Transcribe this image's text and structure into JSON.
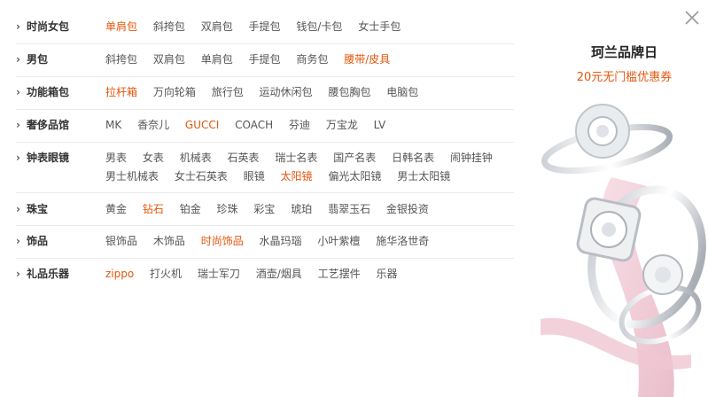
{
  "close_icon": "close-icon",
  "categories": [
    {
      "name": "时尚女包",
      "items": [
        {
          "t": "单肩包",
          "hl": true
        },
        {
          "t": "斜挎包"
        },
        {
          "t": "双肩包"
        },
        {
          "t": "手提包"
        },
        {
          "t": "钱包/卡包"
        },
        {
          "t": "女士手包"
        }
      ]
    },
    {
      "name": "男包",
      "items": [
        {
          "t": "斜挎包"
        },
        {
          "t": "双肩包"
        },
        {
          "t": "单肩包"
        },
        {
          "t": "手提包"
        },
        {
          "t": "商务包"
        },
        {
          "t": "腰带/皮具",
          "hl": true
        }
      ]
    },
    {
      "name": "功能箱包",
      "items": [
        {
          "t": "拉杆箱",
          "hl": true
        },
        {
          "t": "万向轮箱"
        },
        {
          "t": "旅行包"
        },
        {
          "t": "运动休闲包"
        },
        {
          "t": "腰包胸包"
        },
        {
          "t": "电脑包"
        }
      ]
    },
    {
      "name": "奢侈品馆",
      "items": [
        {
          "t": "MK"
        },
        {
          "t": "香奈儿"
        },
        {
          "t": "GUCCI",
          "hl": true
        },
        {
          "t": "COACH"
        },
        {
          "t": "芬迪"
        },
        {
          "t": "万宝龙"
        },
        {
          "t": "LV"
        }
      ]
    },
    {
      "name": "钟表眼镜",
      "items": [
        {
          "t": "男表"
        },
        {
          "t": "女表"
        },
        {
          "t": "机械表"
        },
        {
          "t": "石英表"
        },
        {
          "t": "瑞士名表"
        },
        {
          "t": "国产名表"
        },
        {
          "t": "日韩名表"
        },
        {
          "t": "闹钟挂钟"
        },
        {
          "t": "男士机械表"
        },
        {
          "t": "女士石英表"
        },
        {
          "t": "眼镜"
        },
        {
          "t": "太阳镜",
          "hl": true
        },
        {
          "t": "偏光太阳镜"
        },
        {
          "t": "男士太阳镜"
        }
      ]
    },
    {
      "name": "珠宝",
      "items": [
        {
          "t": "黄金"
        },
        {
          "t": "钻石",
          "hl": true
        },
        {
          "t": "铂金"
        },
        {
          "t": "珍珠"
        },
        {
          "t": "彩宝"
        },
        {
          "t": "琥珀"
        },
        {
          "t": "翡翠玉石"
        },
        {
          "t": "金银投资"
        }
      ]
    },
    {
      "name": "饰品",
      "items": [
        {
          "t": "银饰品"
        },
        {
          "t": "木饰品"
        },
        {
          "t": "时尚饰品",
          "hl": true
        },
        {
          "t": "水晶玛瑙"
        },
        {
          "t": "小叶紫檀"
        },
        {
          "t": "施华洛世奇"
        }
      ]
    },
    {
      "name": "礼品乐器",
      "items": [
        {
          "t": "zippo",
          "hl": true
        },
        {
          "t": "打火机"
        },
        {
          "t": "瑞士军刀"
        },
        {
          "t": "酒壶/烟具"
        },
        {
          "t": "工艺摆件"
        },
        {
          "t": "乐器"
        }
      ]
    }
  ],
  "promo": {
    "title": "珂兰品牌日",
    "subtitle": "20元无门槛优惠券"
  },
  "colors": {
    "highlight": "#e4570d",
    "text": "#555555",
    "category": "#333333",
    "divider": "#ebebeb"
  }
}
